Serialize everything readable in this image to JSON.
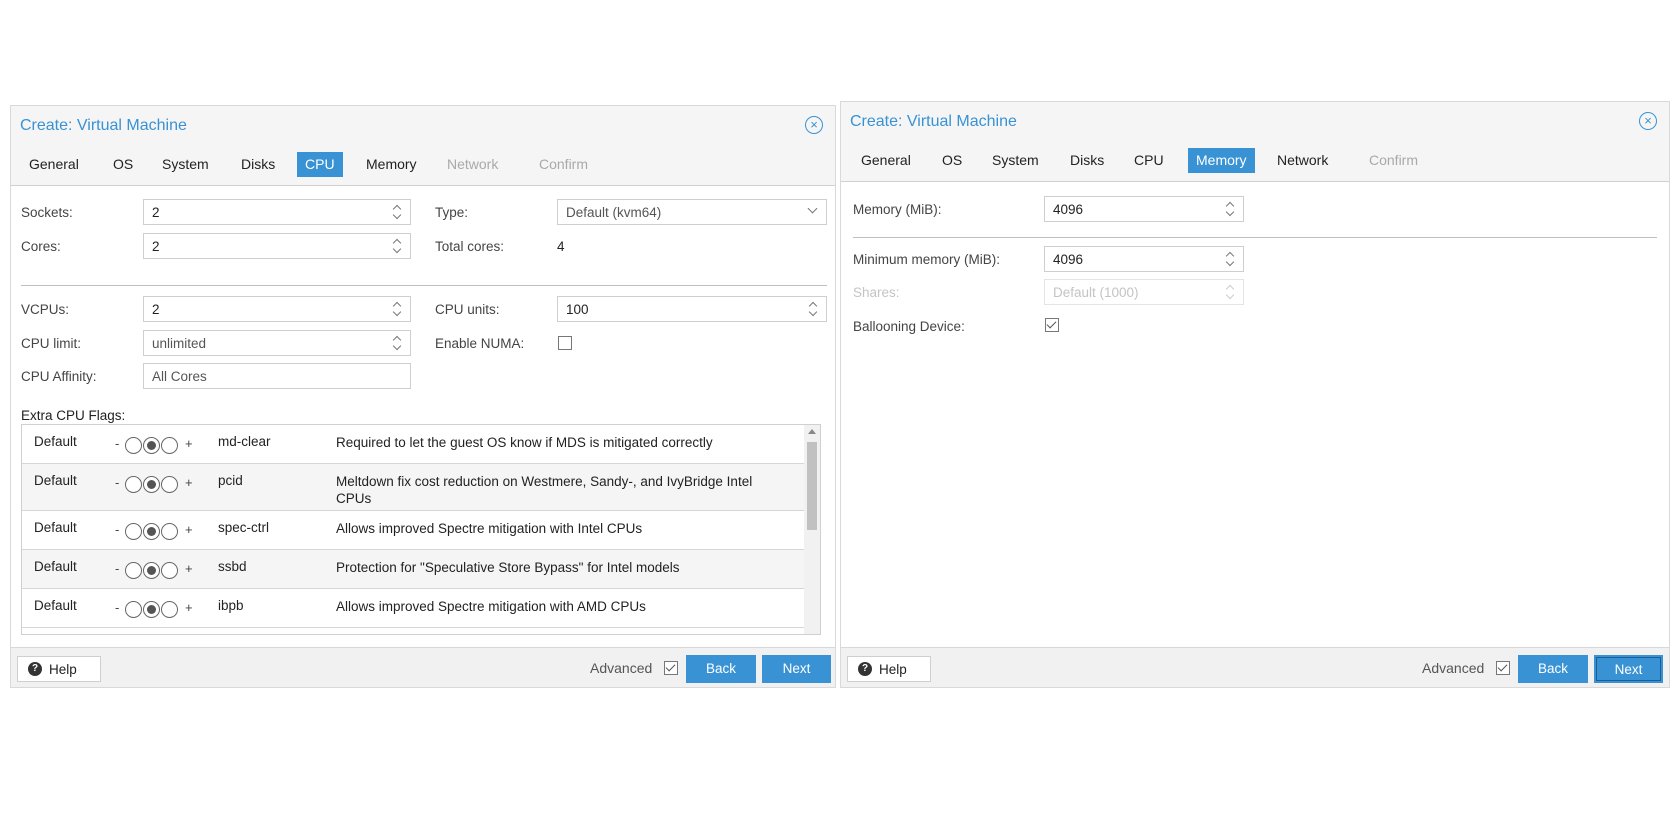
{
  "left_dialog": {
    "title": "Create: Virtual Machine",
    "tabs": [
      {
        "label": "General"
      },
      {
        "label": "OS"
      },
      {
        "label": "System"
      },
      {
        "label": "Disks"
      },
      {
        "label": "CPU"
      },
      {
        "label": "Memory"
      },
      {
        "label": "Network"
      },
      {
        "label": "Confirm"
      }
    ],
    "active_tab": "CPU",
    "fields": {
      "sockets": {
        "label": "Sockets:",
        "value": "2"
      },
      "cores": {
        "label": "Cores:",
        "value": "2"
      },
      "type": {
        "label": "Type:",
        "value": "Default (kvm64)"
      },
      "total_cores": {
        "label": "Total cores:",
        "value": "4"
      },
      "vcpus": {
        "label": "VCPUs:",
        "value": "2"
      },
      "cpu_units": {
        "label": "CPU units:",
        "value": "100"
      },
      "cpu_limit": {
        "label": "CPU limit:",
        "value": "unlimited"
      },
      "enable_numa": {
        "label": "Enable NUMA:",
        "checked": false
      },
      "cpu_affinity": {
        "label": "CPU Affinity:",
        "placeholder": "All Cores"
      }
    },
    "extra_flags_label": "Extra CPU Flags:",
    "flags": [
      {
        "state": "Default",
        "minus": "-",
        "plus": "+",
        "name": "md-clear",
        "description": "Required to let the guest OS know if MDS is mitigated correctly"
      },
      {
        "state": "Default",
        "minus": "-",
        "plus": "+",
        "name": "pcid",
        "description": "Meltdown fix cost reduction on Westmere, Sandy-, and IvyBridge Intel CPUs"
      },
      {
        "state": "Default",
        "minus": "-",
        "plus": "+",
        "name": "spec-ctrl",
        "description": "Allows improved Spectre mitigation with Intel CPUs"
      },
      {
        "state": "Default",
        "minus": "-",
        "plus": "+",
        "name": "ssbd",
        "description": "Protection for \"Speculative Store Bypass\" for Intel models"
      },
      {
        "state": "Default",
        "minus": "-",
        "plus": "+",
        "name": "ibpb",
        "description": "Allows improved Spectre mitigation with AMD CPUs"
      }
    ],
    "footer": {
      "help": "Help",
      "advanced": "Advanced",
      "back": "Back",
      "next": "Next"
    }
  },
  "right_dialog": {
    "title": "Create: Virtual Machine",
    "tabs": [
      {
        "label": "General"
      },
      {
        "label": "OS"
      },
      {
        "label": "System"
      },
      {
        "label": "Disks"
      },
      {
        "label": "CPU"
      },
      {
        "label": "Memory"
      },
      {
        "label": "Network"
      },
      {
        "label": "Confirm"
      }
    ],
    "active_tab": "Memory",
    "fields": {
      "memory": {
        "label": "Memory (MiB):",
        "value": "4096"
      },
      "min_memory": {
        "label": "Minimum memory (MiB):",
        "value": "4096"
      },
      "shares": {
        "label": "Shares:",
        "placeholder": "Default (1000)"
      },
      "ballooning": {
        "label": "Ballooning Device:",
        "checked": true
      }
    },
    "footer": {
      "help": "Help",
      "advanced": "Advanced",
      "back": "Back",
      "next": "Next"
    }
  },
  "icons": {
    "close": "close-circle-icon",
    "help": "question-circle-icon"
  },
  "colors": {
    "accent": "#3892d4",
    "disabled_text": "#a9a9a9"
  }
}
